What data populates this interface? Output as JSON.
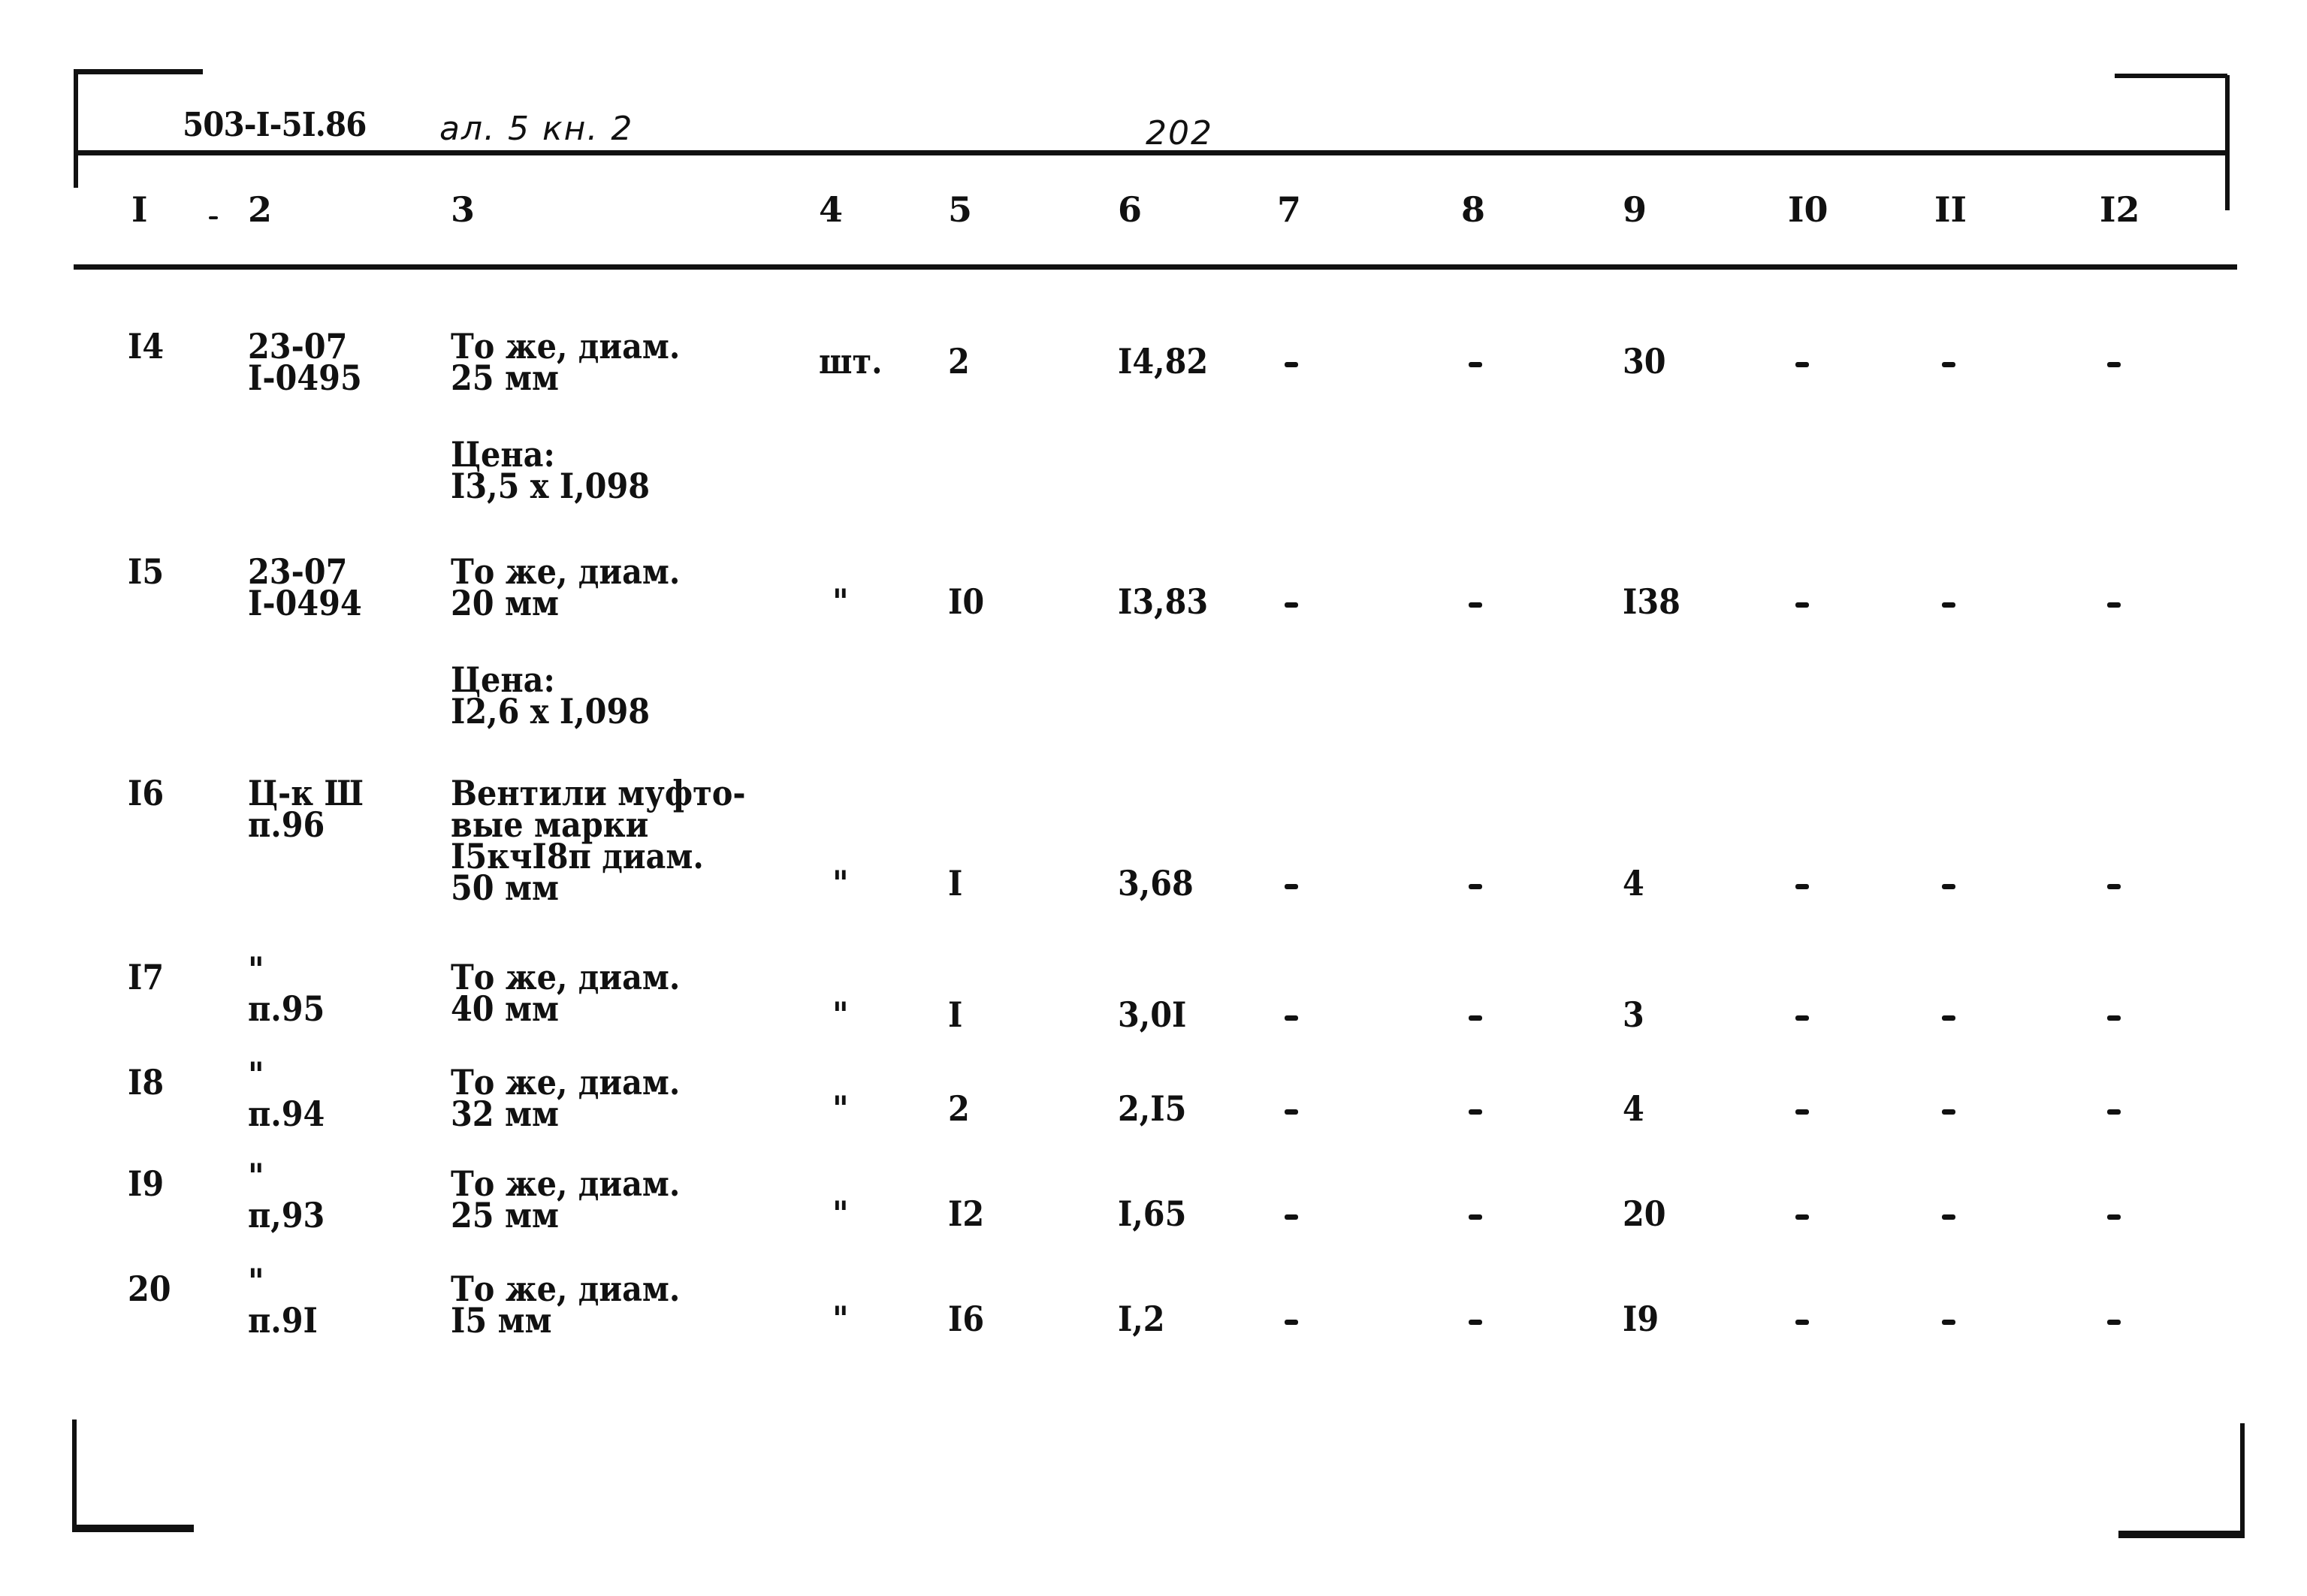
{
  "header": {
    "doc_code": "503-I-5I.86",
    "handwritten_ref": "ал. 5 кн. 2",
    "page_number": "202"
  },
  "columns": [
    "I",
    "2",
    "3",
    "4",
    "5",
    "6",
    "7",
    "8",
    "9",
    "I0",
    "II",
    "I2"
  ],
  "rows": [
    {
      "num": "I4",
      "code": [
        "23-07",
        "I-0495"
      ],
      "description": [
        "То же, диам.",
        "25 мм"
      ],
      "price_note": [
        "Цена:",
        "I3,5 x I,098"
      ],
      "unit": "шт.",
      "qty": "2",
      "price": "I4,82",
      "c7": "-",
      "c8": "-",
      "c9": "30",
      "c10": "-",
      "c11": "-",
      "c12": "-"
    },
    {
      "num": "I5",
      "code": [
        "23-07",
        "I-0494"
      ],
      "description": [
        "То же, диам.",
        "20 мм"
      ],
      "price_note": [
        "Цена:",
        "I2,6 x I,098"
      ],
      "unit": "\"",
      "qty": "I0",
      "price": "I3,83",
      "c7": "-",
      "c8": "-",
      "c9": "I38",
      "c10": "-",
      "c11": "-",
      "c12": "-"
    },
    {
      "num": "I6",
      "code": [
        "Ц-к Ш",
        "п.96"
      ],
      "description": [
        "Вентили муфто-",
        "вые марки",
        "I5кчI8п диам.",
        "50 мм"
      ],
      "unit": "\"",
      "qty": "I",
      "price": "3,68",
      "c7": "-",
      "c8": "-",
      "c9": "4",
      "c10": "-",
      "c11": "-",
      "c12": "-"
    },
    {
      "num": "I7",
      "code": [
        "\"",
        "п.95"
      ],
      "description": [
        "То же, диам.",
        "40 мм"
      ],
      "unit": "\"",
      "qty": "I",
      "price": "3,0I",
      "c7": "-",
      "c8": "-",
      "c9": "3",
      "c10": "-",
      "c11": "-",
      "c12": "-"
    },
    {
      "num": "I8",
      "code": [
        "\"",
        "п.94"
      ],
      "description": [
        "То же, диам.",
        "32 мм"
      ],
      "unit": "\"",
      "qty": "2",
      "price": "2,I5",
      "c7": "-",
      "c8": "-",
      "c9": "4",
      "c10": "-",
      "c11": "-",
      "c12": "-"
    },
    {
      "num": "I9",
      "code": [
        "\"",
        "п,93"
      ],
      "description": [
        "То же, диам.",
        "25 мм"
      ],
      "unit": "\"",
      "qty": "I2",
      "price": "I,65",
      "c7": "-",
      "c8": "-",
      "c9": "20",
      "c10": "-",
      "c11": "-",
      "c12": "-"
    },
    {
      "num": "20",
      "code": [
        "\"",
        "п.9I"
      ],
      "description": [
        "То же, диам.",
        "I5 мм"
      ],
      "unit": "\"",
      "qty": "I6",
      "price": "I,2",
      "c7": "-",
      "c8": "-",
      "c9": "I9",
      "c10": "-",
      "c11": "-",
      "c12": "-"
    }
  ]
}
